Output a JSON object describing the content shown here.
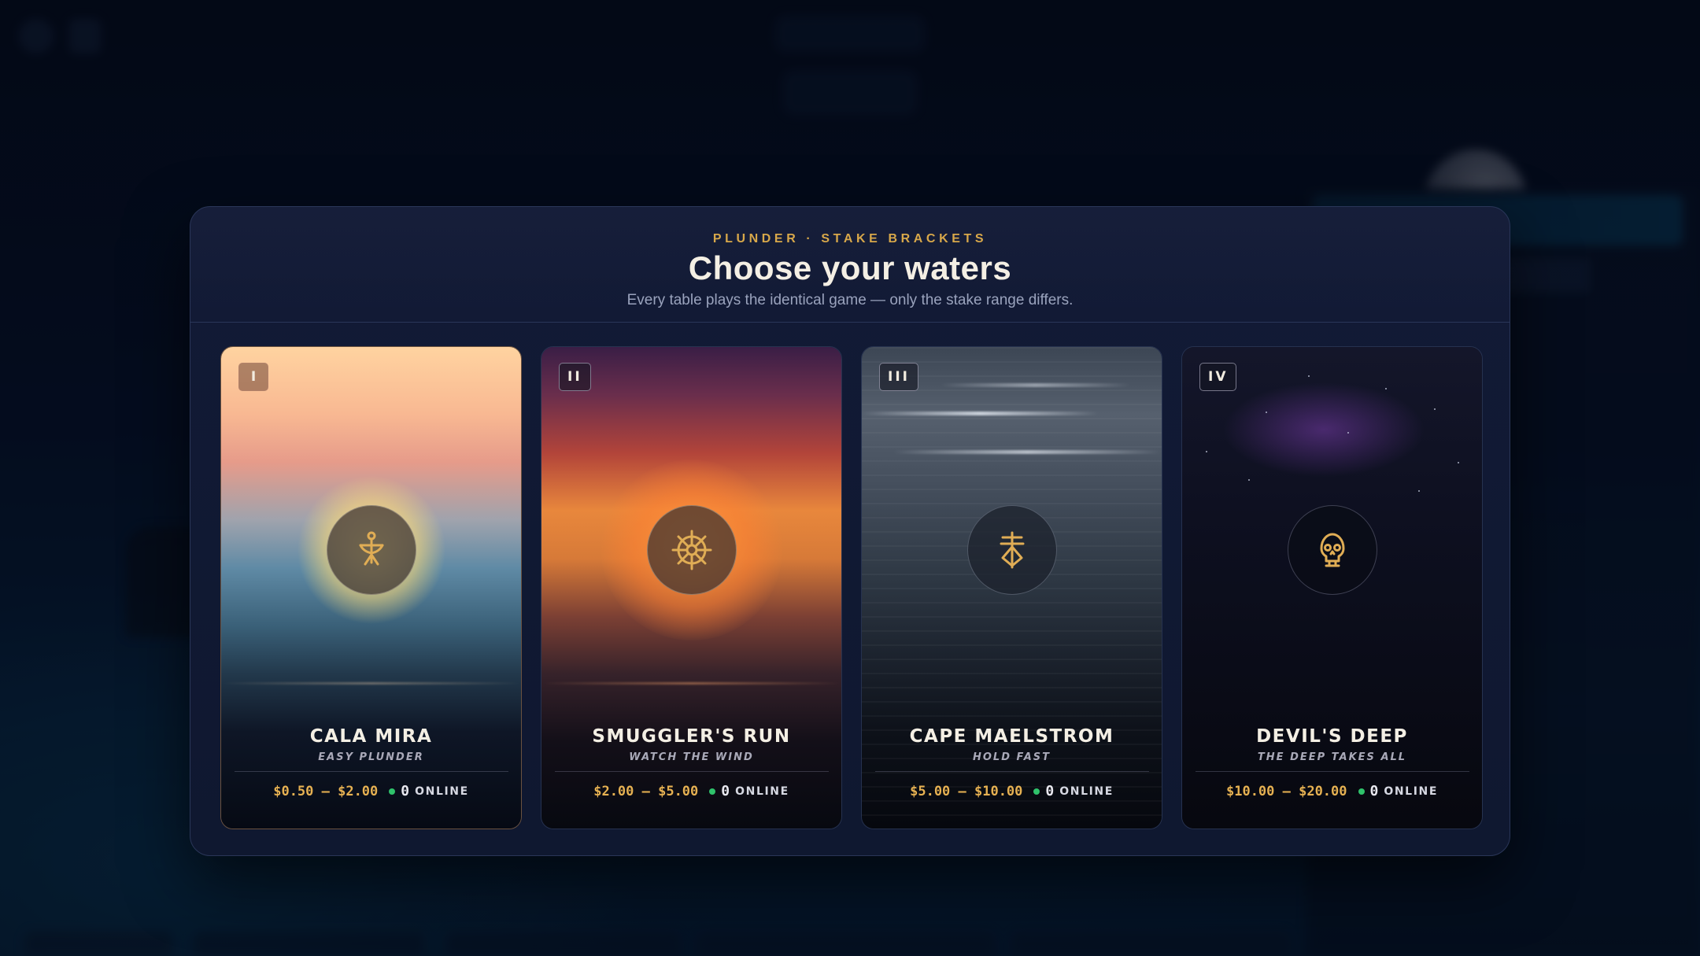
{
  "modal": {
    "eyebrow": "PLUNDER · STAKE BRACKETS",
    "title": "Choose your waters",
    "subtitle": "Every table plays the identical game — only the stake range differs."
  },
  "cards": [
    {
      "numeral": "I",
      "name": "CALA MIRA",
      "tagline": "EASY PLUNDER",
      "stake": "$0.50 – $2.00",
      "online_count": "0",
      "online_label": "ONLINE",
      "icon": "anchor-figure-icon"
    },
    {
      "numeral": "II",
      "name": "SMUGGLER'S RUN",
      "tagline": "WATCH THE WIND",
      "stake": "$2.00 – $5.00",
      "online_count": "0",
      "online_label": "ONLINE",
      "icon": "ship-wheel-icon"
    },
    {
      "numeral": "III",
      "name": "CAPE MAELSTROM",
      "tagline": "HOLD FAST",
      "stake": "$5.00 – $10.00",
      "online_count": "0",
      "online_label": "ONLINE",
      "icon": "trident-icon"
    },
    {
      "numeral": "IV",
      "name": "DEVIL'S DEEP",
      "tagline": "THE DEEP TAKES ALL",
      "stake": "$10.00 – $20.00",
      "online_count": "0",
      "online_label": "ONLINE",
      "icon": "skull-icon"
    }
  ],
  "colors": {
    "accent_gold": "#e6b152",
    "online_green": "#2fc26b",
    "modal_bg": "#121a36"
  }
}
